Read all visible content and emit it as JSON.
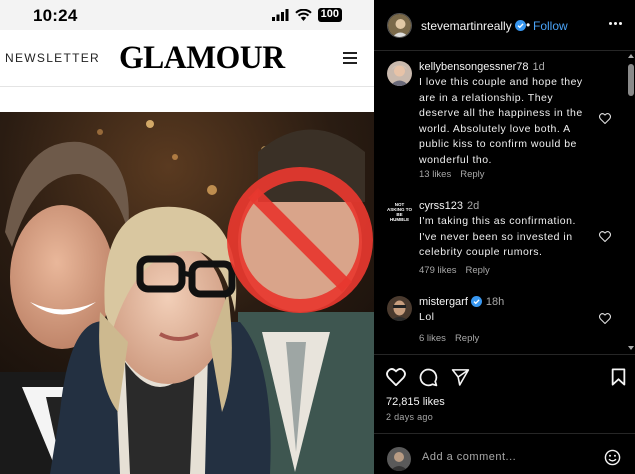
{
  "status_bar": {
    "time": "10:24",
    "battery": "100"
  },
  "site": {
    "newsletter_label": "NEWSLETTER",
    "brand": "GLAMOUR"
  },
  "post": {
    "author": "stevemartinreally",
    "follow_separator": "•",
    "follow_label": "Follow",
    "likes": "72,815 likes",
    "date": "2 days ago",
    "add_comment_placeholder": "Add a comment..."
  },
  "comments": [
    {
      "user": "kellybensongessner78",
      "time": "1d",
      "text": "I love this couple and hope they are in a relationship. They deserve all the happiness in the world. Absolutely love both. A public kiss to confirm would be wonderful tho.",
      "likes": "13 likes",
      "reply": "Reply"
    },
    {
      "user": "cyrss123",
      "time": "2d",
      "text": "I'm taking this as confirmation. I've never been so invested in celebrity couple rumors.",
      "likes": "479 likes",
      "reply": "Reply",
      "avatar_text": "NOT ASKING TO BE HUMBLE"
    },
    {
      "user": "mistergarf",
      "time": "18h",
      "text": "Lol",
      "likes": "6 likes",
      "reply": "Reply"
    }
  ],
  "colors": {
    "link_blue": "#4aa3f7",
    "verified_blue": "#3897f0",
    "prohibit_red": "#e8382f",
    "muted": "#a8a8a8"
  }
}
